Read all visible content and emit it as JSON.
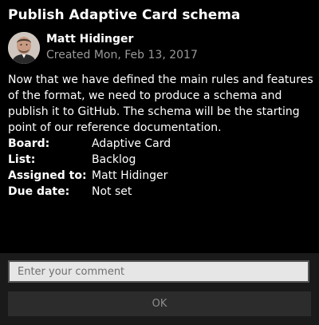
{
  "card": {
    "title": "Publish Adaptive Card schema",
    "author": {
      "name": "Matt Hidinger",
      "created": "Created Mon, Feb 13, 2017"
    },
    "description": "Now that we have defined the main rules and features of the format, we need to produce a schema and publish it to GitHub. The schema will be the starting point of our reference documentation.",
    "facts": [
      {
        "key": "Board:",
        "value": "Adaptive Card"
      },
      {
        "key": "List:",
        "value": "Backlog"
      },
      {
        "key": "Assigned to:",
        "value": "Matt Hidinger"
      },
      {
        "key": "Due date:",
        "value": "Not set"
      }
    ]
  },
  "actions": {
    "comment_placeholder": "Enter your comment",
    "comment_value": "",
    "ok_label": "OK"
  },
  "colors": {
    "background": "#000000",
    "text": "#ffffff",
    "subtle_text": "#9a9a9a",
    "action_area": "#1a1a1a",
    "button": "#2c2c2c",
    "input": "#e6e6e6"
  }
}
